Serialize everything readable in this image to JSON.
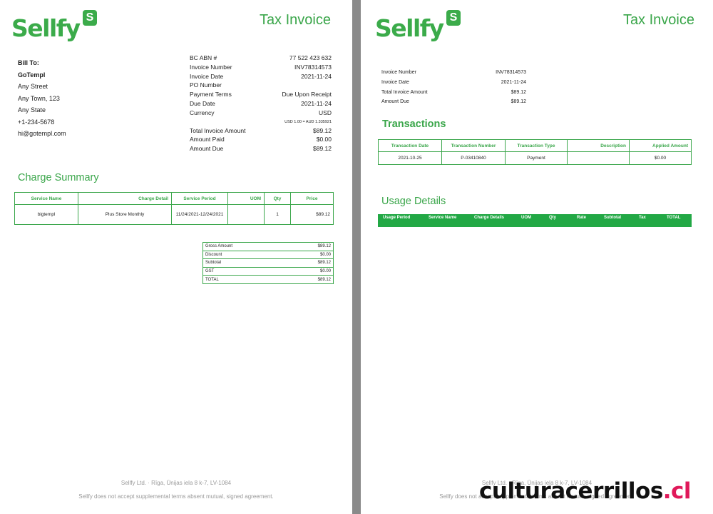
{
  "brand": {
    "name": "Sellfy",
    "badge": "S",
    "color": "#3bab4a"
  },
  "doc_title": "Tax Invoice",
  "page1": {
    "bill_to": {
      "label": "Bill To:",
      "name": "GoTempl",
      "street": "Any Street",
      "town": "Any Town, 123",
      "state": "Any State",
      "phone": "+1-234-5678",
      "email": "hi@gotempl.com"
    },
    "info": [
      {
        "label": "BC ABN #",
        "value": "77 522 423 632"
      },
      {
        "label": "Invoice Number",
        "value": "INV78314573"
      },
      {
        "label": "Invoice Date",
        "value": "2021-11-24"
      },
      {
        "label": "PO Number",
        "value": ""
      },
      {
        "label": "Payment Terms",
        "value": "Due Upon Receipt"
      },
      {
        "label": "Due Date",
        "value": "2021-11-24"
      },
      {
        "label": "Currency",
        "value": "USD"
      }
    ],
    "exchange_note": "USD 1.00 = AUD 1.335921",
    "amounts": [
      {
        "label": "Total Invoice Amount",
        "value": "$89.12"
      },
      {
        "label": "Amount Paid",
        "value": "$0.00"
      },
      {
        "label": "Amount Due",
        "value": "$89.12"
      }
    ],
    "charge_summary": {
      "title": "Charge Summary",
      "headers": [
        "Service Name",
        "Charge Detail",
        "Service Period",
        "UOM",
        "Qty",
        "Price"
      ],
      "rows": [
        [
          "bigtempl",
          "Plus Store Monthly",
          "11/24/2021-12/24/2021",
          "",
          "1",
          "$89.12"
        ]
      ]
    },
    "totals": [
      {
        "label": "Gross Amount",
        "value": "$89.12"
      },
      {
        "label": "Discount",
        "value": "$0.00"
      },
      {
        "label": "Subtotal",
        "value": "$89.12"
      },
      {
        "label": "GST",
        "value": "$0.00"
      },
      {
        "label": "TOTAL",
        "value": "$89.12"
      }
    ]
  },
  "page2": {
    "info": [
      {
        "label": "Invoice Number",
        "value": "INV78314573"
      },
      {
        "label": "Invoice Date",
        "value": "2021-11-24"
      },
      {
        "label": "Total Invoice Amount",
        "value": "$89.12"
      },
      {
        "label": "Amount Due",
        "value": "$89.12"
      }
    ],
    "transactions": {
      "title": "Transactions",
      "headers": [
        "Transaction Date",
        "Transaction Number",
        "Transaction Type",
        "Description",
        "Applied Amount"
      ],
      "rows": [
        [
          "2021-10-25",
          "P-03410840",
          "Payment",
          "",
          "$0.00"
        ]
      ]
    },
    "usage": {
      "title": "Usage Details",
      "headers": [
        "Usage Period",
        "Service Name",
        "Charge Details",
        "UOM",
        "Qty",
        "Rate",
        "Subtotal",
        "Tax",
        "TOTAL"
      ]
    }
  },
  "footer": {
    "address": "Sellfy Ltd. · Rīga, Ūnijas iela 8 k-7, LV-1084",
    "terms": "Sellfy does not accept supplemental terms absent mutual, signed agreement."
  },
  "watermark": {
    "main": "culturacerrillos",
    "suffix": ".cl"
  }
}
